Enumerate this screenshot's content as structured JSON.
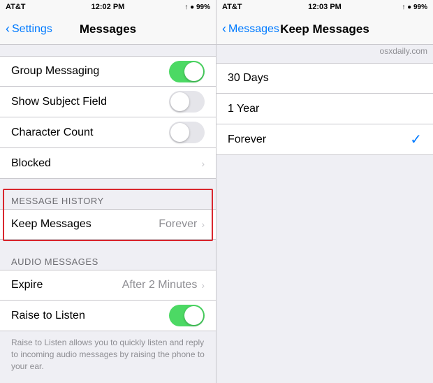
{
  "left": {
    "statusBar": {
      "carrier": "AT&T",
      "time": "12:02 PM",
      "signal": "▲ ● 99%"
    },
    "navBar": {
      "backLabel": "Settings",
      "title": "Messages"
    },
    "rows": [
      {
        "id": "group-messaging",
        "label": "Group Messaging",
        "type": "toggle",
        "value": "on"
      },
      {
        "id": "show-subject",
        "label": "Show Subject Field",
        "type": "toggle",
        "value": "off"
      },
      {
        "id": "character-count",
        "label": "Character Count",
        "type": "toggle",
        "value": "off"
      },
      {
        "id": "blocked",
        "label": "Blocked",
        "type": "chevron"
      }
    ],
    "messageHistorySection": {
      "header": "MESSAGE HISTORY",
      "rows": [
        {
          "id": "keep-messages",
          "label": "Keep Messages",
          "value": "Forever",
          "type": "chevron"
        }
      ]
    },
    "audioSection": {
      "header": "AUDIO MESSAGES",
      "rows": [
        {
          "id": "expire",
          "label": "Expire",
          "value": "After 2 Minutes",
          "type": "chevron"
        },
        {
          "id": "raise-to-listen",
          "label": "Raise to Listen",
          "type": "toggle",
          "value": "on"
        }
      ],
      "description": "Raise to Listen allows you to quickly listen and reply to incoming audio messages by raising the phone to your ear."
    }
  },
  "right": {
    "statusBar": {
      "carrier": "AT&T",
      "time": "12:03 PM",
      "signal": "▲ ● 99%"
    },
    "navBar": {
      "backLabel": "Messages",
      "title": "Keep Messages"
    },
    "watermark": "osxdaily.com",
    "options": [
      {
        "id": "30-days",
        "label": "30 Days",
        "selected": false
      },
      {
        "id": "1-year",
        "label": "1 Year",
        "selected": false
      },
      {
        "id": "forever",
        "label": "Forever",
        "selected": true
      }
    ]
  }
}
